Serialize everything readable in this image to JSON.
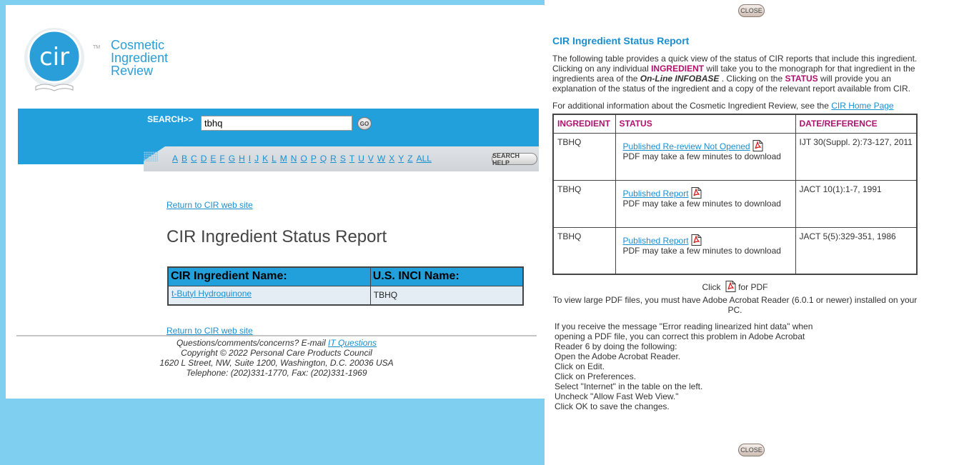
{
  "logo": {
    "line1": "Cosmetic",
    "line2": "Ingredient",
    "line3": "Review",
    "tm": "TM",
    "mark": "cir"
  },
  "search": {
    "label": "SEARCH>>",
    "value": "tbhq",
    "go_label": "GO",
    "help_label": "SEARCH HELP"
  },
  "alphabet": [
    "A",
    "B",
    "C",
    "D",
    "E",
    "F",
    "G",
    "H",
    "I",
    "J",
    "K",
    "L",
    "M",
    "N",
    "O",
    "P",
    "Q",
    "R",
    "S",
    "T",
    "U",
    "V",
    "W",
    "X",
    "Y",
    "Z",
    "ALL"
  ],
  "main": {
    "return_link": "Return to CIR web site",
    "title": "CIR Ingredient Status Report",
    "table": {
      "headers": [
        "CIR Ingredient Name:",
        "U.S. INCI Name:"
      ],
      "row": {
        "ingredient": "t-Butyl Hydroquinone",
        "inci": "TBHQ"
      }
    }
  },
  "footer": {
    "line1_prefix": "Questions/comments/concerns? E-mail ",
    "line1_link": "IT Questions",
    "line2": "Copyright © 2022 Personal Care Products Council",
    "line3": "1620 L Street, NW, Suite 1200, Washington, D.C. 20036 USA",
    "line4": "Telephone: (202)331-1770, Fax: (202)331-1969"
  },
  "panel": {
    "close_label": "CLOSE",
    "title": "CIR Ingredient Status Report",
    "intro": {
      "p1": "The following table provides a quick view of the status of CIR reports that include this ingredient. Clicking on any individual ",
      "kw1": "INGREDIENT",
      "p2": " will take you to the monograph for that ingredient in the ingredients area of the ",
      "kw_italic": "On-Line INFOBASE",
      "p3": " . Clicking on the ",
      "kw2": "STATUS",
      "p4": " will provide you an explanation of the status of the ingredient and a copy of the relevant report available from CIR."
    },
    "additional_prefix": "For additional information about the Cosmetic Ingredient Review, see the ",
    "additional_link": "CIR Home Page",
    "table": {
      "headers": [
        "INGREDIENT",
        "STATUS",
        "DATE/REFERENCE"
      ],
      "rows": [
        {
          "ingredient": "TBHQ",
          "status": "Published Re-review Not Opened",
          "note": "PDF may take a few minutes to download",
          "reference": "IJT 30(Suppl. 2):73-127, 2011"
        },
        {
          "ingredient": "TBHQ",
          "status": "Published Report",
          "note": "PDF may take a few minutes to download",
          "reference": "JACT 10(1):1-7, 1991"
        },
        {
          "ingredient": "TBHQ",
          "status": "Published Report",
          "note": "PDF may take a few minutes to download",
          "reference": "JACT 5(5):329-351, 1986"
        }
      ]
    },
    "pdf_note": {
      "click": "Click",
      "for_pdf": " for PDF",
      "line2": "To view large PDF files, you must have Adobe Acrobat Reader (6.0.1 or newer) installed on your PC."
    },
    "hint_lines": [
      "If you receive the message \"Error reading linearized hint data\" when opening a PDF file, you can correct this problem in Adobe Acrobat Reader 6 by doing the following:",
      "Open the Adobe Acrobat Reader.",
      "Click on Edit.",
      "Click on Preferences.",
      "Select \"Internet\" in the table on the left.",
      "Uncheck \"Allow Fast Web View.\"",
      "Click OK to save the changes."
    ]
  }
}
